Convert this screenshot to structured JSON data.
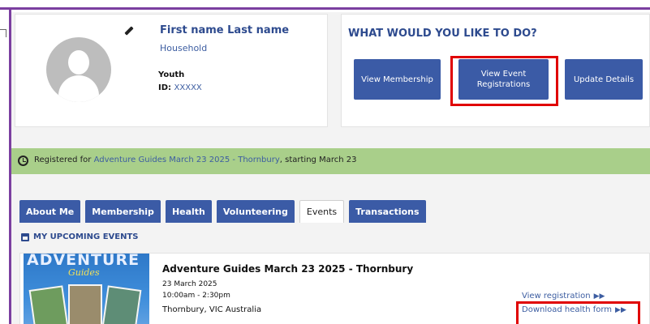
{
  "profile": {
    "name": "First name Last name",
    "household": "Household",
    "type": "Youth",
    "id_label": "ID:",
    "id_value": "XXXXX"
  },
  "actions": {
    "title": "WHAT WOULD YOU LIKE TO DO?",
    "buttons": [
      {
        "label": "View Membership"
      },
      {
        "label": "View Event Registrations"
      },
      {
        "label": "Update Details"
      }
    ]
  },
  "banner": {
    "prefix": "Registered for",
    "event_link": "Adventure Guides March 23 2025 - Thornbury",
    "suffix": ", starting March 23"
  },
  "tabs": [
    {
      "label": "About Me",
      "active": false
    },
    {
      "label": "Membership",
      "active": false
    },
    {
      "label": "Health",
      "active": false
    },
    {
      "label": "Volunteering",
      "active": false
    },
    {
      "label": "Events",
      "active": true
    },
    {
      "label": "Transactions",
      "active": false
    }
  ],
  "upcoming": {
    "heading": "MY UPCOMING EVENTS"
  },
  "event": {
    "image_title": "ADVENTURE",
    "image_subtitle": "Guides",
    "title": "Adventure Guides March 23 2025 - Thornbury",
    "date": "23 March 2025",
    "time": "10:00am - 2:30pm",
    "location": "Thornbury, VIC Australia",
    "view_registration": "View registration",
    "download_health_form": "Download health form"
  },
  "colors": {
    "frame": "#7b3fa0",
    "primary": "#3b5ba6",
    "highlight": "#e00000",
    "banner": "#a9cf8a"
  }
}
